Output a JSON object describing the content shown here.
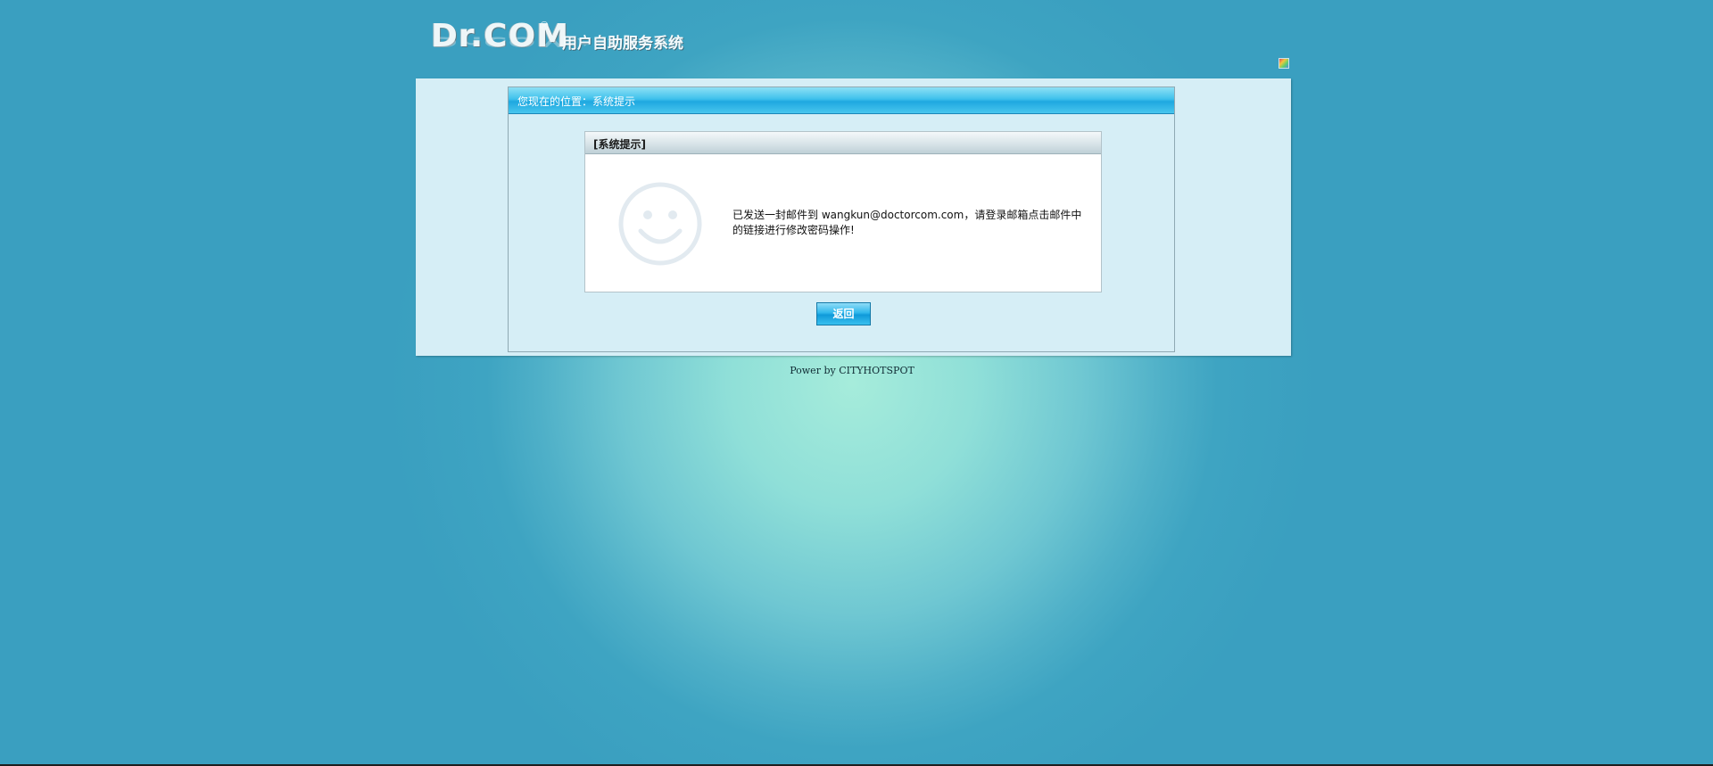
{
  "header": {
    "logo_text": "Dr.COM",
    "logo_registered": "®",
    "subtitle": "用户自助服务系统"
  },
  "breadcrumb": {
    "text": "您现在的位置：系统提示"
  },
  "dialog": {
    "title": "[系统提示]",
    "icon": "smiley-icon",
    "message": "已发送一封邮件到 wangkun@doctorcom.com，请登录邮箱点击邮件中的链接进行修改密码操作!"
  },
  "actions": {
    "back_label": "返回"
  },
  "footer": {
    "text": "Power by CITYHOTSPOT"
  },
  "colors": {
    "background": "#3a9fc0",
    "panel": "#d6eef6",
    "accent": "#1ea8e0"
  }
}
